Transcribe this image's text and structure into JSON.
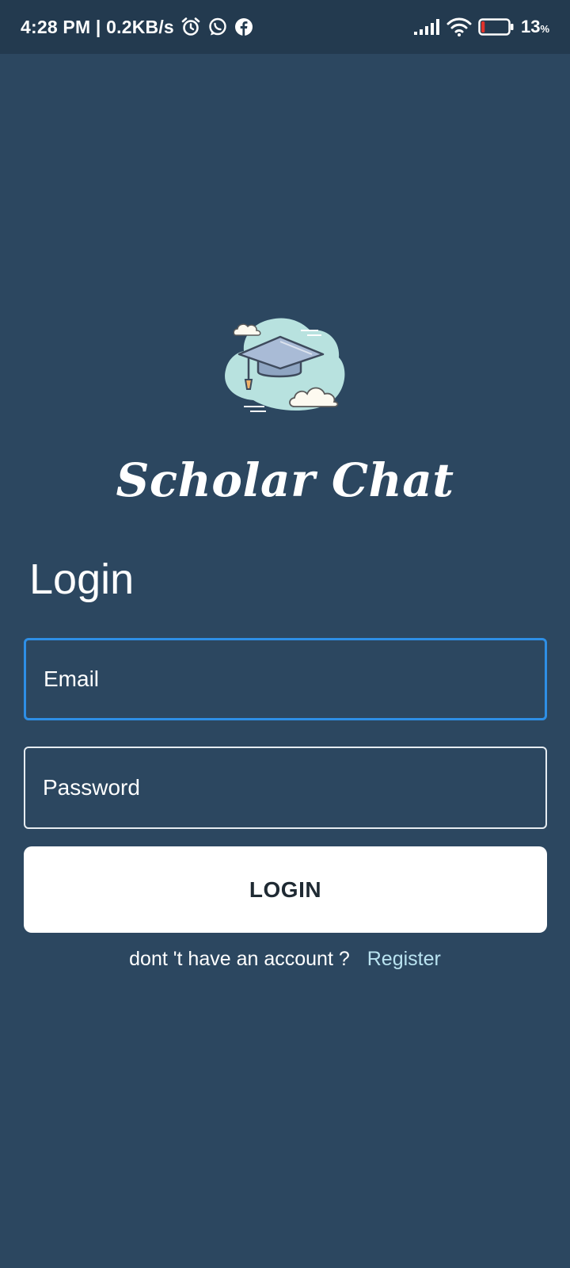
{
  "status_bar": {
    "time_speed": "4:28 PM | 0.2KB/s",
    "battery_percent": "13",
    "battery_unit": "%",
    "battery_level": 0.13,
    "battery_color": "#e0322b",
    "icons": [
      "alarm-icon",
      "whatsapp-icon",
      "facebook-icon",
      "signal-icon",
      "wifi-icon",
      "battery-icon"
    ]
  },
  "app": {
    "brand": "Scholar Chat",
    "logo_icon": "graduation-cap-cloud-icon"
  },
  "login": {
    "heading": "Login",
    "email_placeholder": "Email",
    "password_placeholder": "Password",
    "button_label": "LOGIN",
    "no_account_text": "dont 't have an account ?",
    "register_link": "Register"
  },
  "colors": {
    "background": "#2c4760",
    "status_bar": "#233a4f",
    "focus_border": "#2e8fe6",
    "link": "#b9e3f0"
  }
}
